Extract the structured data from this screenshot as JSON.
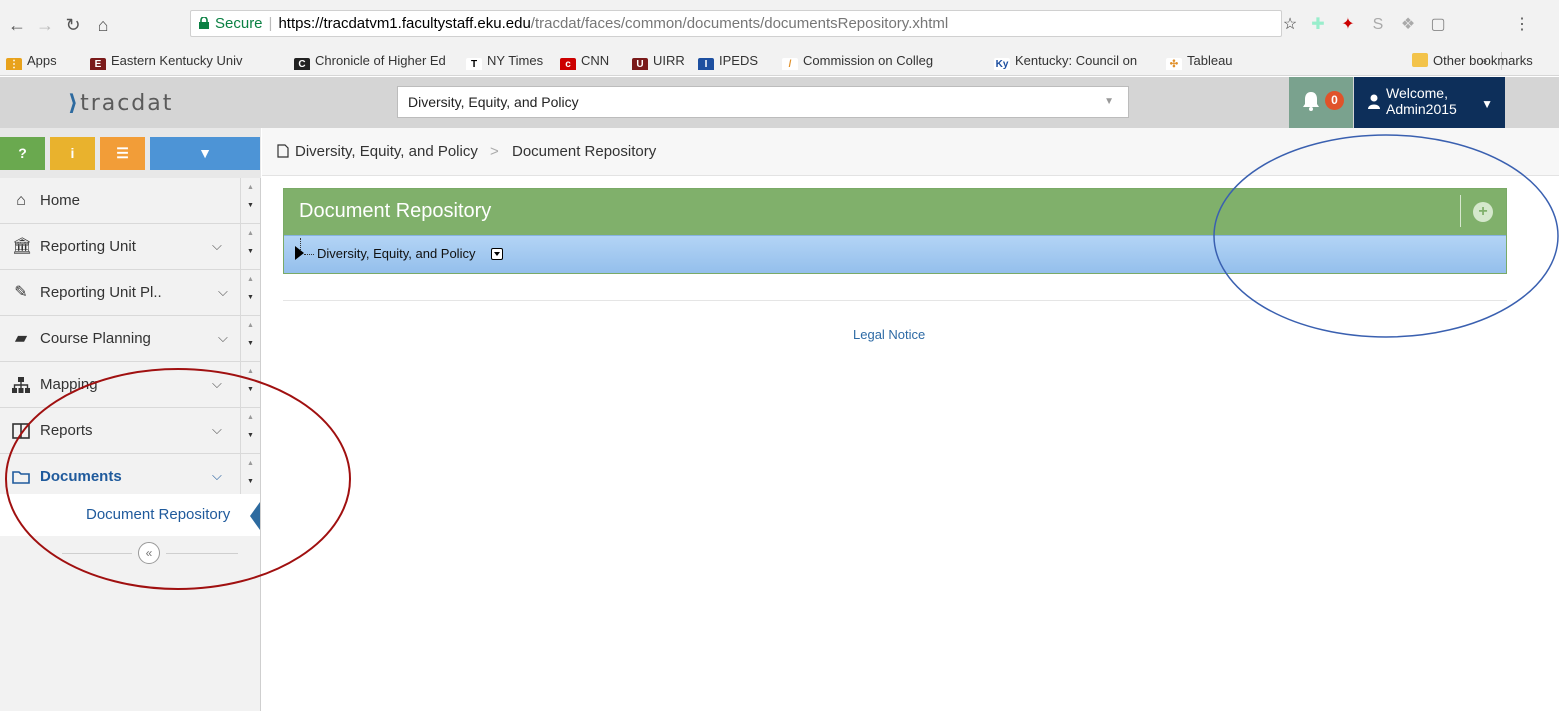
{
  "browser": {
    "secure_label": "Secure",
    "url_host": "https://tracdatvm1.facultystaff.eku.edu",
    "url_path": "/tracdat/faces/common/documents/documentsRepository.xhtml",
    "bookmarks": [
      {
        "label": "Apps",
        "icon": "apps-grid-icon"
      },
      {
        "label": "Eastern Kentucky Univ",
        "icon": "eku-icon"
      },
      {
        "label": "Chronicle of Higher Ed",
        "icon": "chronicle-icon"
      },
      {
        "label": "NY Times",
        "icon": "nytimes-icon"
      },
      {
        "label": "CNN",
        "icon": "cnn-icon"
      },
      {
        "label": "UIRR",
        "icon": "uirr-icon"
      },
      {
        "label": "IPEDS",
        "icon": "ipeds-icon"
      },
      {
        "label": "Commission on Colleg",
        "icon": "commission-icon"
      },
      {
        "label": "Kentucky: Council on",
        "icon": "ky-icon"
      },
      {
        "label": "Tableau",
        "icon": "tableau-icon"
      }
    ],
    "overflow_label": "»",
    "other_bookmarks": "Other bookmarks"
  },
  "header": {
    "logo_text": "tracdat",
    "reporting_unit_select": "Diversity, Equity, and Policy",
    "notification_count": "0",
    "welcome_line1": "Welcome,",
    "welcome_line2": "Admin2015"
  },
  "sidebar": {
    "tools": [
      {
        "label": "?",
        "color": "#6aa94f"
      },
      {
        "label": "i",
        "color": "#e9b22d"
      },
      {
        "label": "☰",
        "color": "#f29d38"
      },
      {
        "label": "▼",
        "color": "#4d94d6"
      }
    ],
    "items": [
      {
        "label": "Home",
        "icon": "home-icon"
      },
      {
        "label": "Reporting Unit",
        "icon": "institution-icon"
      },
      {
        "label": "Reporting Unit Pl..",
        "icon": "pencil-icon"
      },
      {
        "label": "Course Planning",
        "icon": "book-icon"
      },
      {
        "label": "Mapping",
        "icon": "sitemap-icon"
      },
      {
        "label": "Reports",
        "icon": "columns-icon"
      },
      {
        "label": "Documents",
        "icon": "folder-icon"
      }
    ],
    "subitem": "Document Repository",
    "collapse_label": "«"
  },
  "breadcrumb": {
    "unit": "Diversity, Equity, and Policy",
    "separator": ">",
    "page": "Document Repository"
  },
  "main": {
    "panel_title": "Document Repository",
    "tree_root": "Diversity, Equity, and Policy",
    "legal_notice": "Legal Notice"
  },
  "colors": {
    "panel_green": "#80b06b",
    "welcome_navy": "#0d2f5a",
    "annotation_red": "#a01010",
    "annotation_blue": "#3a60b0"
  }
}
